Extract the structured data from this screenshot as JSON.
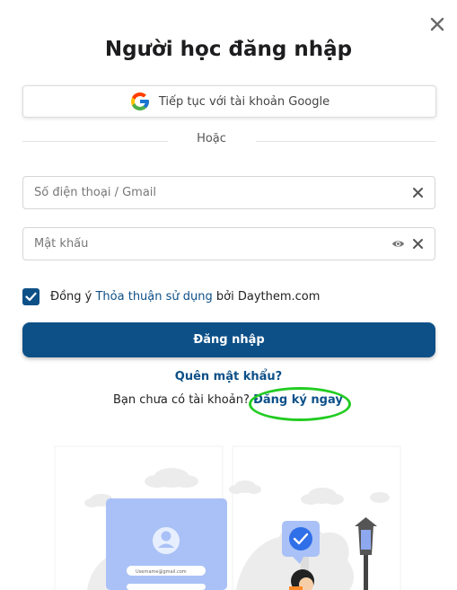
{
  "dialog": {
    "title": "Người học đăng nhập",
    "close_icon": "close-icon"
  },
  "google": {
    "label": "Tiếp tục với tài khoản Google",
    "icon": "google-logo-icon"
  },
  "divider": {
    "text": "Hoặc"
  },
  "phone_field": {
    "placeholder": "Số điện thoại / Gmail",
    "value": ""
  },
  "password_field": {
    "placeholder": "Mật khẩu",
    "value": ""
  },
  "agree": {
    "checked": true,
    "prefix": "Đồng ý ",
    "link": "Thỏa thuận sử dụng",
    "suffix": " bởi Daythem.com"
  },
  "login_button": {
    "label": "Đăng nhập"
  },
  "forgot_password": {
    "label": "Quên mật khẩu?"
  },
  "signup": {
    "prompt": "Bạn chưa có tài khoản? ",
    "link": "Đăng ký ngay"
  },
  "illustration": {
    "email_text": "Username@gmail.com"
  },
  "colors": {
    "primary": "#0d5088",
    "highlight": "#22cc22",
    "border": "#d6d6d6"
  }
}
